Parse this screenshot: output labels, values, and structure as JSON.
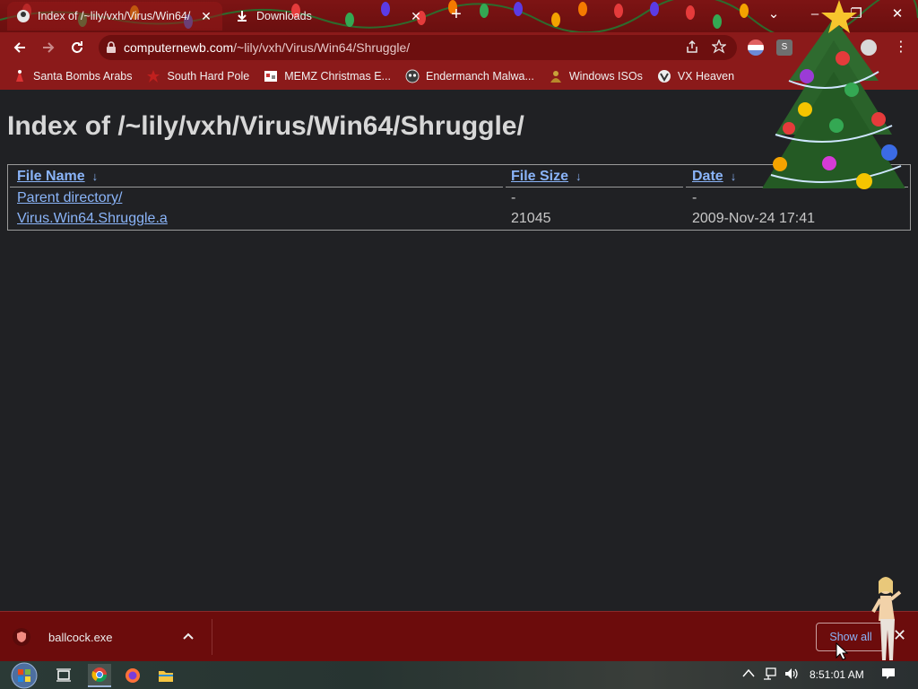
{
  "browser": {
    "tabs": [
      {
        "title": "Index of /~lily/vxh/Virus/Win64/",
        "active": true,
        "icon": "page-favicon"
      },
      {
        "title": "Downloads",
        "active": false,
        "icon": "download-icon"
      }
    ],
    "new_tab_label": "+",
    "window_controls": {
      "dropdown": "⌄",
      "minimize": "–",
      "restore": "❐",
      "close": "✕"
    }
  },
  "toolbar": {
    "url_host": "computernewb.com",
    "url_path": "/~lily/vxh/Virus/Win64/Shruggle/"
  },
  "bookmarks": [
    {
      "label": "Santa Bombs Arabs",
      "icon": "santa-icon"
    },
    {
      "label": "South Hard Pole",
      "icon": "red-star-icon"
    },
    {
      "label": "MEMZ Christmas E...",
      "icon": "memz-icon"
    },
    {
      "label": "Endermanch Malwa...",
      "icon": "enderman-icon"
    },
    {
      "label": "Windows ISOs",
      "icon": "buddha-icon"
    },
    {
      "label": "VX Heaven",
      "icon": "vx-icon"
    }
  ],
  "page": {
    "title": "Index of /~lily/vxh/Virus/Win64/Shruggle/",
    "columns": {
      "name": "File Name",
      "size": "File Size",
      "date": "Date",
      "sort_arrow": "↓"
    },
    "rows": [
      {
        "name": "Parent directory/",
        "size": "-",
        "date": "-"
      },
      {
        "name": "Virus.Win64.Shruggle.a",
        "size": "21045",
        "date": "2009-Nov-24 17:41"
      }
    ]
  },
  "downloads": {
    "file": "ballcock.exe",
    "show_all_label": "Show all"
  },
  "taskbar": {
    "clock": "8:51:01 AM"
  },
  "colors": {
    "tab_strip": "#7d1414",
    "toolbar": "#8b1a1a",
    "page_bg": "#202124",
    "link": "#8ab4f8",
    "download_bar": "#6c0c0c"
  }
}
